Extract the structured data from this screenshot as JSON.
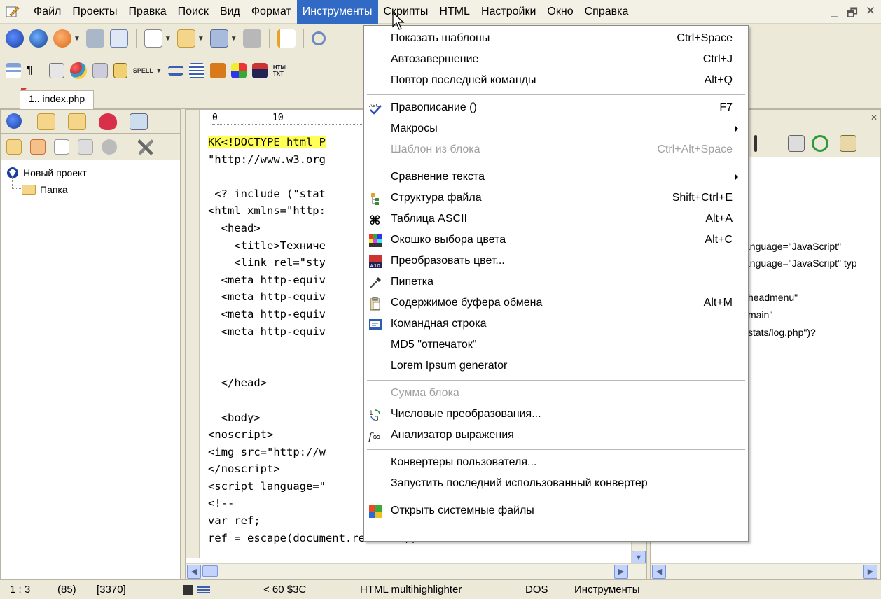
{
  "menubar": {
    "items": [
      "Файл",
      "Проекты",
      "Правка",
      "Поиск",
      "Вид",
      "Формат",
      "Инструменты",
      "Скрипты",
      "HTML",
      "Настройки",
      "Окно",
      "Справка"
    ],
    "active_index": 6,
    "window_controls": {
      "minimize": "_",
      "restore": "🗗",
      "close": "✕"
    }
  },
  "tab": {
    "label": "1.. index.php"
  },
  "project_tree": {
    "root": "Новый проект",
    "child": "Папка"
  },
  "editor": {
    "ruler_0": "0",
    "ruler_10": "10",
    "lines": [
      "KK<!DOCTYPE html P",
      "\"http://www.w3.org",
      "",
      " <? include (\"stat",
      "<html xmlns=\"http:",
      "  <head>",
      "    <title>Техниче",
      "    <link rel=\"sty",
      "  <meta http-equiv",
      "  <meta http-equiv",
      "  <meta http-equiv",
      "  <meta http-equiv",
      "",
      "",
      "  </head>",
      "",
      "  <body>",
      "<noscript>",
      "<img src=\"http://w",
      "</noscript>",
      "<script language=\"",
      "<!--",
      "var ref;",
      "ref = escape(document.referrer);"
    ]
  },
  "right_panel": {
    "lines": [
      "t",
      "anguage=\"JavaScript\"",
      "anguage=\"JavaScript\" typ",
      "t",
      "\"headmenu\"",
      "\"main\"",
      "\"stats/log.php\")?"
    ]
  },
  "tools_menu": {
    "items": [
      {
        "label": "Показать шаблоны",
        "shortcut": "Ctrl+Space",
        "icon": "",
        "disabled": false,
        "submenu": false
      },
      {
        "label": "Автозавершение",
        "shortcut": "Ctrl+J",
        "icon": "",
        "disabled": false,
        "submenu": false
      },
      {
        "label": "Повтор последней команды",
        "shortcut": "Alt+Q",
        "icon": "",
        "disabled": false,
        "submenu": false
      },
      {
        "sep": true
      },
      {
        "label": "Правописание ()",
        "shortcut": "F7",
        "icon": "spellcheck-icon",
        "disabled": false,
        "submenu": false
      },
      {
        "label": "Макросы",
        "shortcut": "",
        "icon": "",
        "disabled": false,
        "submenu": true
      },
      {
        "label": "Шаблон из блока",
        "shortcut": "Ctrl+Alt+Space",
        "icon": "",
        "disabled": true,
        "submenu": false
      },
      {
        "sep": true
      },
      {
        "label": "Сравнение текста",
        "shortcut": "",
        "icon": "",
        "disabled": false,
        "submenu": true
      },
      {
        "label": "Структура файла",
        "shortcut": "Shift+Ctrl+E",
        "icon": "structure-icon",
        "disabled": false,
        "submenu": false
      },
      {
        "label": "Таблица ASCII",
        "shortcut": "Alt+A",
        "icon": "ascii-table-icon",
        "disabled": false,
        "submenu": false
      },
      {
        "label": "Окошко выбора цвета",
        "shortcut": "Alt+C",
        "icon": "color-picker-icon",
        "disabled": false,
        "submenu": false
      },
      {
        "label": "Преобразовать цвет...",
        "shortcut": "",
        "icon": "convert-color-icon",
        "disabled": false,
        "submenu": false
      },
      {
        "label": "Пипетка",
        "shortcut": "",
        "icon": "eyedropper-icon",
        "disabled": false,
        "submenu": false
      },
      {
        "label": "Содержимое буфера обмена",
        "shortcut": "Alt+M",
        "icon": "clipboard-icon",
        "disabled": false,
        "submenu": false
      },
      {
        "label": "Командная строка",
        "shortcut": "",
        "icon": "command-line-icon",
        "disabled": false,
        "submenu": false
      },
      {
        "label": "MD5 \"отпечаток\"",
        "shortcut": "",
        "icon": "",
        "disabled": false,
        "submenu": false
      },
      {
        "label": "Lorem Ipsum generator",
        "shortcut": "",
        "icon": "",
        "disabled": false,
        "submenu": false
      },
      {
        "sep": true
      },
      {
        "label": "Сумма блока",
        "shortcut": "",
        "icon": "",
        "disabled": true,
        "submenu": false
      },
      {
        "label": "Числовые преобразования...",
        "shortcut": "",
        "icon": "number-convert-icon",
        "disabled": false,
        "submenu": false
      },
      {
        "label": "Анализатор выражения",
        "shortcut": "",
        "icon": "expression-icon",
        "disabled": false,
        "submenu": false
      },
      {
        "sep": true
      },
      {
        "label": "Конвертеры пользователя...",
        "shortcut": "",
        "icon": "",
        "disabled": false,
        "submenu": false
      },
      {
        "label": "Запустить последний использованный конвертер",
        "shortcut": "",
        "icon": "",
        "disabled": false,
        "submenu": false
      },
      {
        "sep": true
      },
      {
        "label": "Открыть системные файлы",
        "shortcut": "",
        "icon": "system-files-icon",
        "disabled": false,
        "submenu": false
      }
    ]
  },
  "statusbar": {
    "position": "1 : 3",
    "line_count": "(85)",
    "char_count": "[3370]",
    "char_code": "<  60  $3C",
    "highlighter": "HTML multihighlighter",
    "eol": "DOS",
    "hint": "Инструменты"
  },
  "colors": {
    "menu_highlight": "#316ac5",
    "code_highlight": "#ffff55",
    "tag": "#000080"
  }
}
